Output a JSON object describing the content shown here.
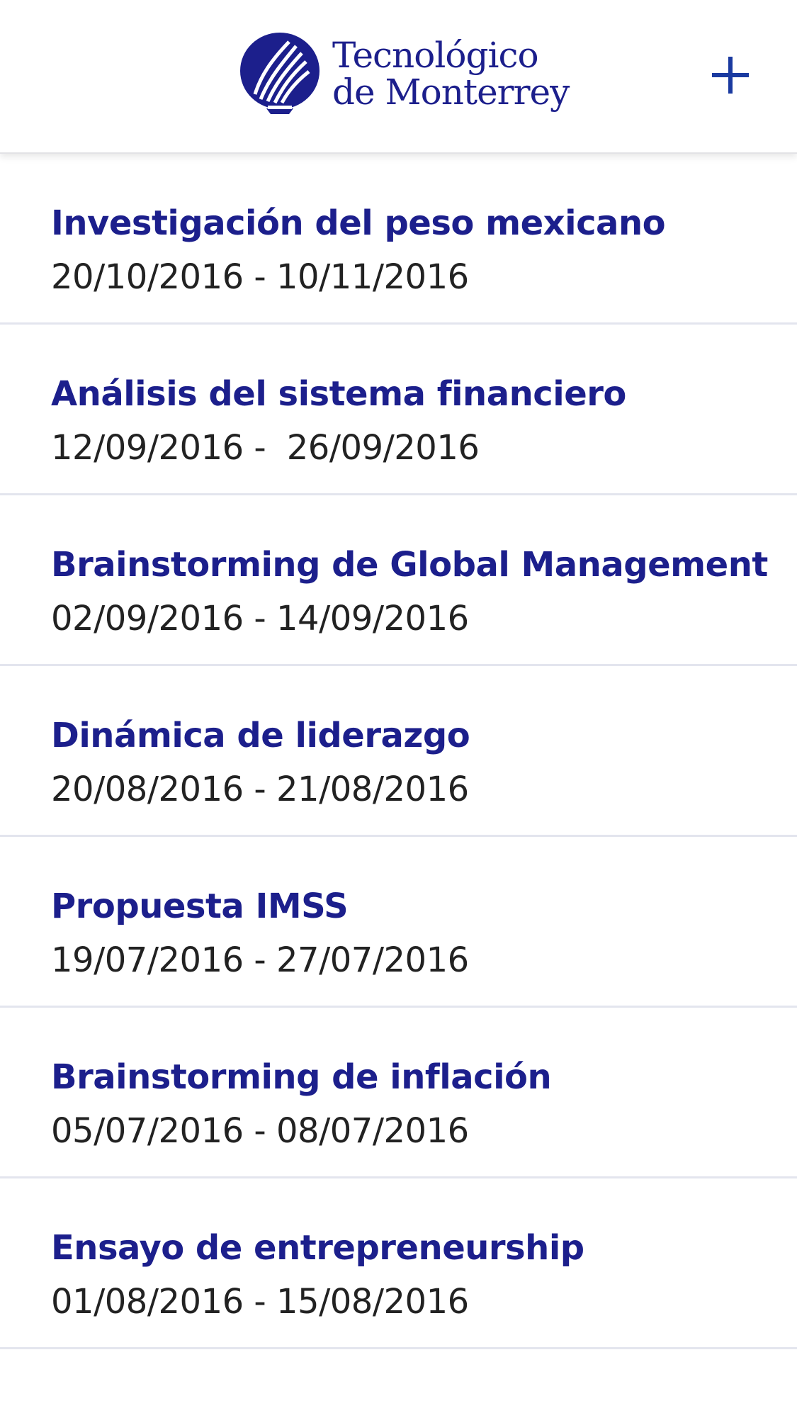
{
  "header": {
    "logo_line1": "Tecnológico",
    "logo_line2": "de Monterrey",
    "logo_icon": "flame-logo-icon",
    "add_icon": "plus-icon"
  },
  "colors": {
    "title": "#1c1f8c",
    "dates": "#222222",
    "accent": "#1a3aa0",
    "divider": "#e3e5ee"
  },
  "items": [
    {
      "title": "Investigación del peso mexicano",
      "dates": "20/10/2016 - 10/11/2016"
    },
    {
      "title": "Análisis del sistema financiero",
      "dates": "12/09/2016 -  26/09/2016"
    },
    {
      "title": "Brainstorming de Global Management",
      "dates": "02/09/2016 - 14/09/2016"
    },
    {
      "title": "Dinámica de liderazgo",
      "dates": "20/08/2016 - 21/08/2016"
    },
    {
      "title": "Propuesta IMSS",
      "dates": "19/07/2016 - 27/07/2016"
    },
    {
      "title": "Brainstorming de inflación",
      "dates": "05/07/2016 - 08/07/2016"
    },
    {
      "title": "Ensayo de entrepreneurship",
      "dates": "01/08/2016 - 15/08/2016"
    }
  ]
}
